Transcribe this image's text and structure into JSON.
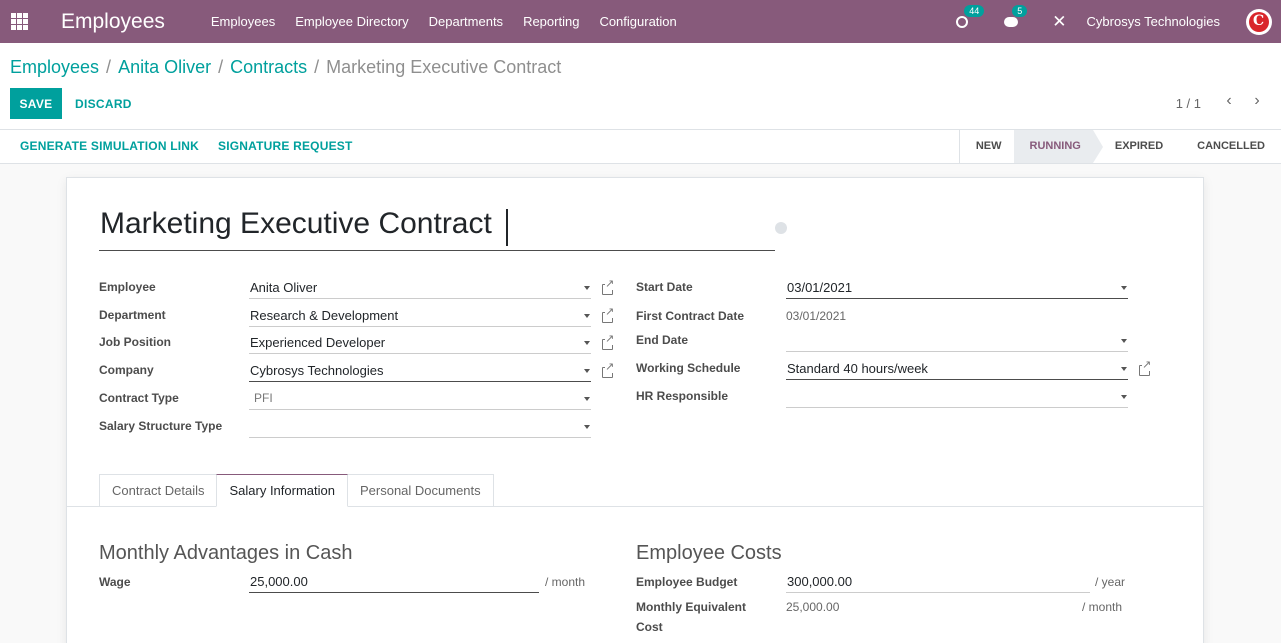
{
  "navbar": {
    "app_title": "Employees",
    "menu": [
      "Employees",
      "Employee Directory",
      "Departments",
      "Reporting",
      "Configuration"
    ],
    "activity_count": "44",
    "message_count": "5",
    "company": "Cybrosys Technologies"
  },
  "breadcrumb": {
    "items": [
      "Employees",
      "Anita Oliver",
      "Contracts"
    ],
    "current": "Marketing Executive Contract",
    "separator": "/"
  },
  "buttons": {
    "save": "SAVE",
    "discard": "DISCARD"
  },
  "pager": {
    "value": "1 / 1"
  },
  "actions": {
    "simulation": "GENERATE SIMULATION LINK",
    "signature": "SIGNATURE REQUEST"
  },
  "stages": [
    "NEW",
    "RUNNING",
    "EXPIRED",
    "CANCELLED"
  ],
  "current_stage": "RUNNING",
  "form": {
    "title": "Marketing Executive Contract",
    "left": {
      "employee": {
        "label": "Employee",
        "value": "Anita Oliver"
      },
      "department": {
        "label": "Department",
        "value": "Research & Development"
      },
      "job_position": {
        "label": "Job Position",
        "value": "Experienced Developer"
      },
      "company": {
        "label": "Company",
        "value": "Cybrosys Technologies"
      },
      "contract_type": {
        "label": "Contract Type",
        "value": "PFI"
      },
      "salary_structure": {
        "label": "Salary Structure Type",
        "value": ""
      }
    },
    "right": {
      "start_date": {
        "label": "Start Date",
        "value": "03/01/2021"
      },
      "first_contract_date": {
        "label": "First Contract Date",
        "value": "03/01/2021"
      },
      "end_date": {
        "label": "End Date",
        "value": ""
      },
      "working_schedule": {
        "label": "Working Schedule",
        "value": "Standard 40 hours/week"
      },
      "hr_responsible": {
        "label": "HR Responsible",
        "value": ""
      }
    }
  },
  "tabs": [
    "Contract Details",
    "Salary Information",
    "Personal Documents"
  ],
  "active_tab": "Salary Information",
  "salary": {
    "cash_title": "Monthly Advantages in Cash",
    "wage_label": "Wage",
    "wage_value": "25,000.00",
    "wage_unit": "/ month",
    "costs_title": "Employee Costs",
    "budget_label": "Employee Budget",
    "budget_value": "300,000.00",
    "budget_unit": "/ year",
    "monthly_label_1": "Monthly Equivalent",
    "monthly_label_2": "Cost",
    "monthly_value": "25,000.00",
    "monthly_unit": "/ month"
  },
  "colors": {
    "brand": "#875a7b",
    "accent": "#00a09d"
  }
}
